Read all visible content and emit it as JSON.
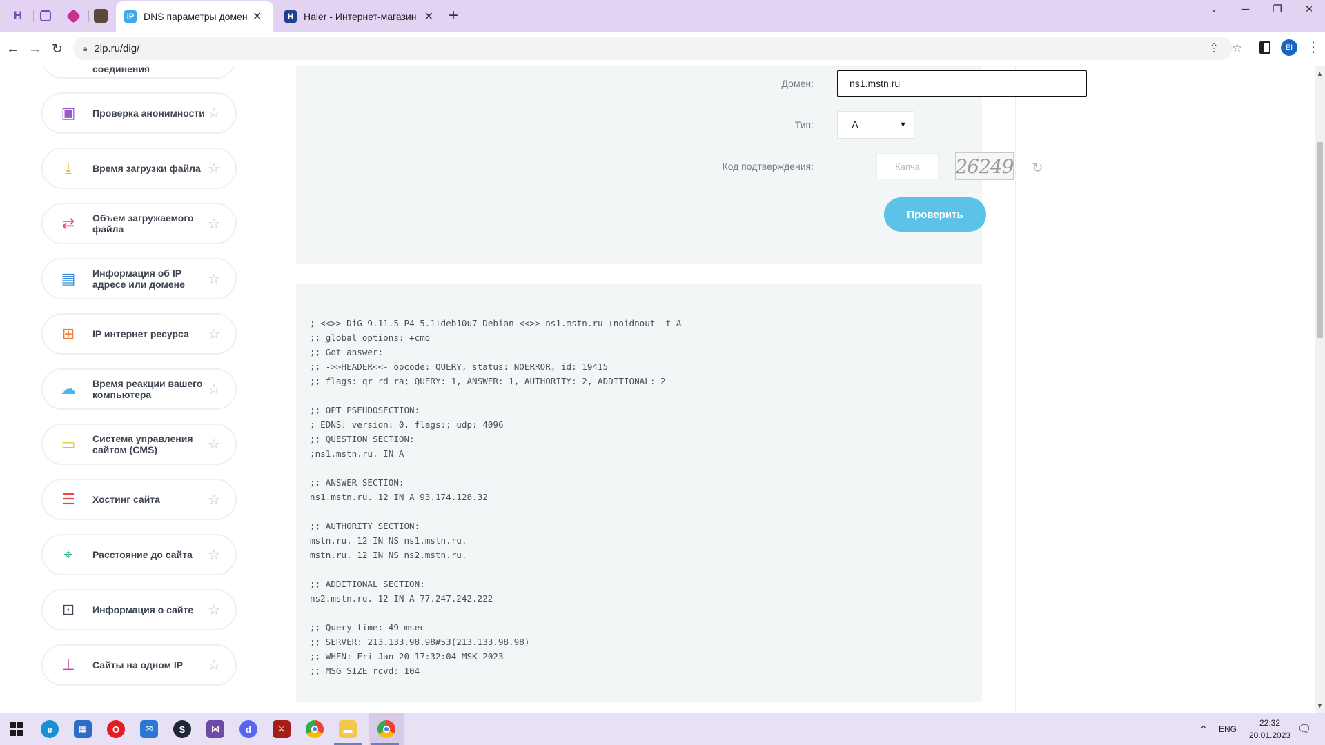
{
  "browser": {
    "tabs": [
      {
        "label": "DNS параметры домена",
        "favicon": "IP",
        "active": true
      },
      {
        "label": "Haier - Интернет-магазин бытовой",
        "favicon": "H",
        "active": false
      }
    ],
    "url": "2ip.ru/dig/",
    "profile_initials": "EI"
  },
  "sidebar": {
    "items": [
      {
        "label": "соединения",
        "icon": "connection-icon",
        "color": "#2db36b"
      },
      {
        "label": "Проверка анонимности",
        "icon": "lock-window-icon",
        "color": "#9b59d0"
      },
      {
        "label": "Время загрузки файла",
        "icon": "download-icon",
        "color": "#f0b429"
      },
      {
        "label": "Объем загружаемого файла",
        "icon": "file-size-icon",
        "color": "#e8467c"
      },
      {
        "label": "Информация об IP адресе или домене",
        "icon": "computer-icon",
        "color": "#3b8fd9"
      },
      {
        "label": "IP интернет ресурса",
        "icon": "web-resource-icon",
        "color": "#f07a3a"
      },
      {
        "label": "Время реакции вашего компьютера",
        "icon": "monitor-cloud-icon",
        "color": "#48b6e8"
      },
      {
        "label": "Система управления сайтом (CMS)",
        "icon": "terminal-window-icon",
        "color": "#e3c62c"
      },
      {
        "label": "Хостинг сайта",
        "icon": "server-icon",
        "color": "#e84545"
      },
      {
        "label": "Расстояние до сайта",
        "icon": "map-pin-icon",
        "color": "#2bb37c"
      },
      {
        "label": "Информация о сайте",
        "icon": "site-search-icon",
        "color": "#3d4552"
      },
      {
        "label": "Сайты на одном IP",
        "icon": "sitemap-icon",
        "color": "#c43ab8"
      }
    ]
  },
  "form": {
    "domain_label": "Домен:",
    "domain_value": "ns1.mstn.ru",
    "type_label": "Тип:",
    "type_value": "A",
    "captcha_label": "Код подтверждения:",
    "captcha_placeholder": "Капча",
    "captcha_image_text": "26249",
    "submit_label": "Проверить"
  },
  "result": {
    "lines": [
      "; <<>> DiG 9.11.5-P4-5.1+deb10u7-Debian <<>> ns1.mstn.ru +noidnout -t A",
      ";; global options: +cmd",
      ";; Got answer:",
      ";; ->>HEADER<<- opcode: QUERY, status: NOERROR, id: 19415",
      ";; flags: qr rd ra; QUERY: 1, ANSWER: 1, AUTHORITY: 2, ADDITIONAL: 2",
      "",
      ";; OPT PSEUDOSECTION:",
      "; EDNS: version: 0, flags:; udp: 4096",
      ";; QUESTION SECTION:",
      ";ns1.mstn.ru. IN A",
      "",
      ";; ANSWER SECTION:",
      "ns1.mstn.ru. 12 IN A 93.174.128.32",
      "",
      ";; AUTHORITY SECTION:",
      "mstn.ru. 12 IN NS ns1.mstn.ru.",
      "mstn.ru. 12 IN NS ns2.mstn.ru.",
      "",
      ";; ADDITIONAL SECTION:",
      "ns2.mstn.ru. 12 IN A 77.247.242.222",
      "",
      ";; Query time: 49 msec",
      ";; SERVER: 213.133.98.98#53(213.133.98.98)",
      ";; WHEN: Fri Jan 20 17:32:04 MSK 2023",
      ";; MSG SIZE rcvd: 104"
    ]
  },
  "taskbar": {
    "lang": "ENG",
    "time": "22:32",
    "date": "20.01.2023"
  }
}
